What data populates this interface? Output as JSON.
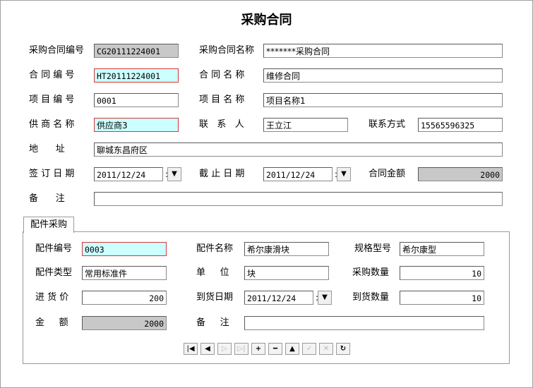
{
  "title": "采购合同",
  "form": {
    "purchase_contract_no": {
      "label": "采购合同编号",
      "value": "CG20111224001"
    },
    "purchase_contract_name": {
      "label": "采购合同名称",
      "value": "*******采购合同"
    },
    "contract_no": {
      "label": "合 同 编 号",
      "value": "HT20111224001"
    },
    "contract_name": {
      "label": "合 同 名 称",
      "value": "维修合同"
    },
    "project_no": {
      "label": "项 目 编 号",
      "value": "0001"
    },
    "project_name": {
      "label": "项 目 名 称",
      "value": "项目名称1"
    },
    "supplier_name": {
      "label": "供 商 名 称",
      "value": "供应商3"
    },
    "contact": {
      "label": "联   系   人",
      "value": "王立江"
    },
    "contact_info": {
      "label": "联系方式",
      "value": "15565596325"
    },
    "address": {
      "label": "地      址",
      "value": "聊城东昌府区"
    },
    "sign_date": {
      "label": "签 订 日 期",
      "value": "2011/12/24"
    },
    "end_date": {
      "label": "截 止 日 期",
      "value": "2011/12/24"
    },
    "contract_amount": {
      "label": "合同金额",
      "value": "2000"
    },
    "remark": {
      "label": "备      注",
      "value": ""
    }
  },
  "parts_tab": {
    "label": "配件采购",
    "part_no": {
      "label": "配件编号",
      "value": "0003"
    },
    "part_name": {
      "label": "配件名称",
      "value": "希尔康滑块"
    },
    "spec": {
      "label": "规格型号",
      "value": "希尔康型"
    },
    "part_type": {
      "label": "配件类型",
      "value": "常用标准件"
    },
    "unit": {
      "label": "单     位",
      "value": "块"
    },
    "purchase_qty": {
      "label": "采购数量",
      "value": "10"
    },
    "purchase_price": {
      "label": "进 货 价",
      "value": "200"
    },
    "arrival_date": {
      "label": "到货日期",
      "value": "2011/12/24"
    },
    "arrival_qty": {
      "label": "到货数量",
      "value": "10"
    },
    "amount": {
      "label": "金     额",
      "value": "2000"
    },
    "remark": {
      "label": "备     注",
      "value": ""
    }
  },
  "navigator": {
    "first": "first-record-icon",
    "prior": "prior-record-icon",
    "next": "next-record-icon",
    "last": "last-record-icon",
    "insert": "plus-icon",
    "delete": "minus-icon",
    "edit": "up-triangle-icon",
    "post": "check-icon",
    "cancel": "x-icon",
    "refresh": "refresh-icon"
  },
  "colors": {
    "readonly": "#c8c8c8",
    "required": "#ccffff",
    "required_border": "#d23a3a"
  }
}
